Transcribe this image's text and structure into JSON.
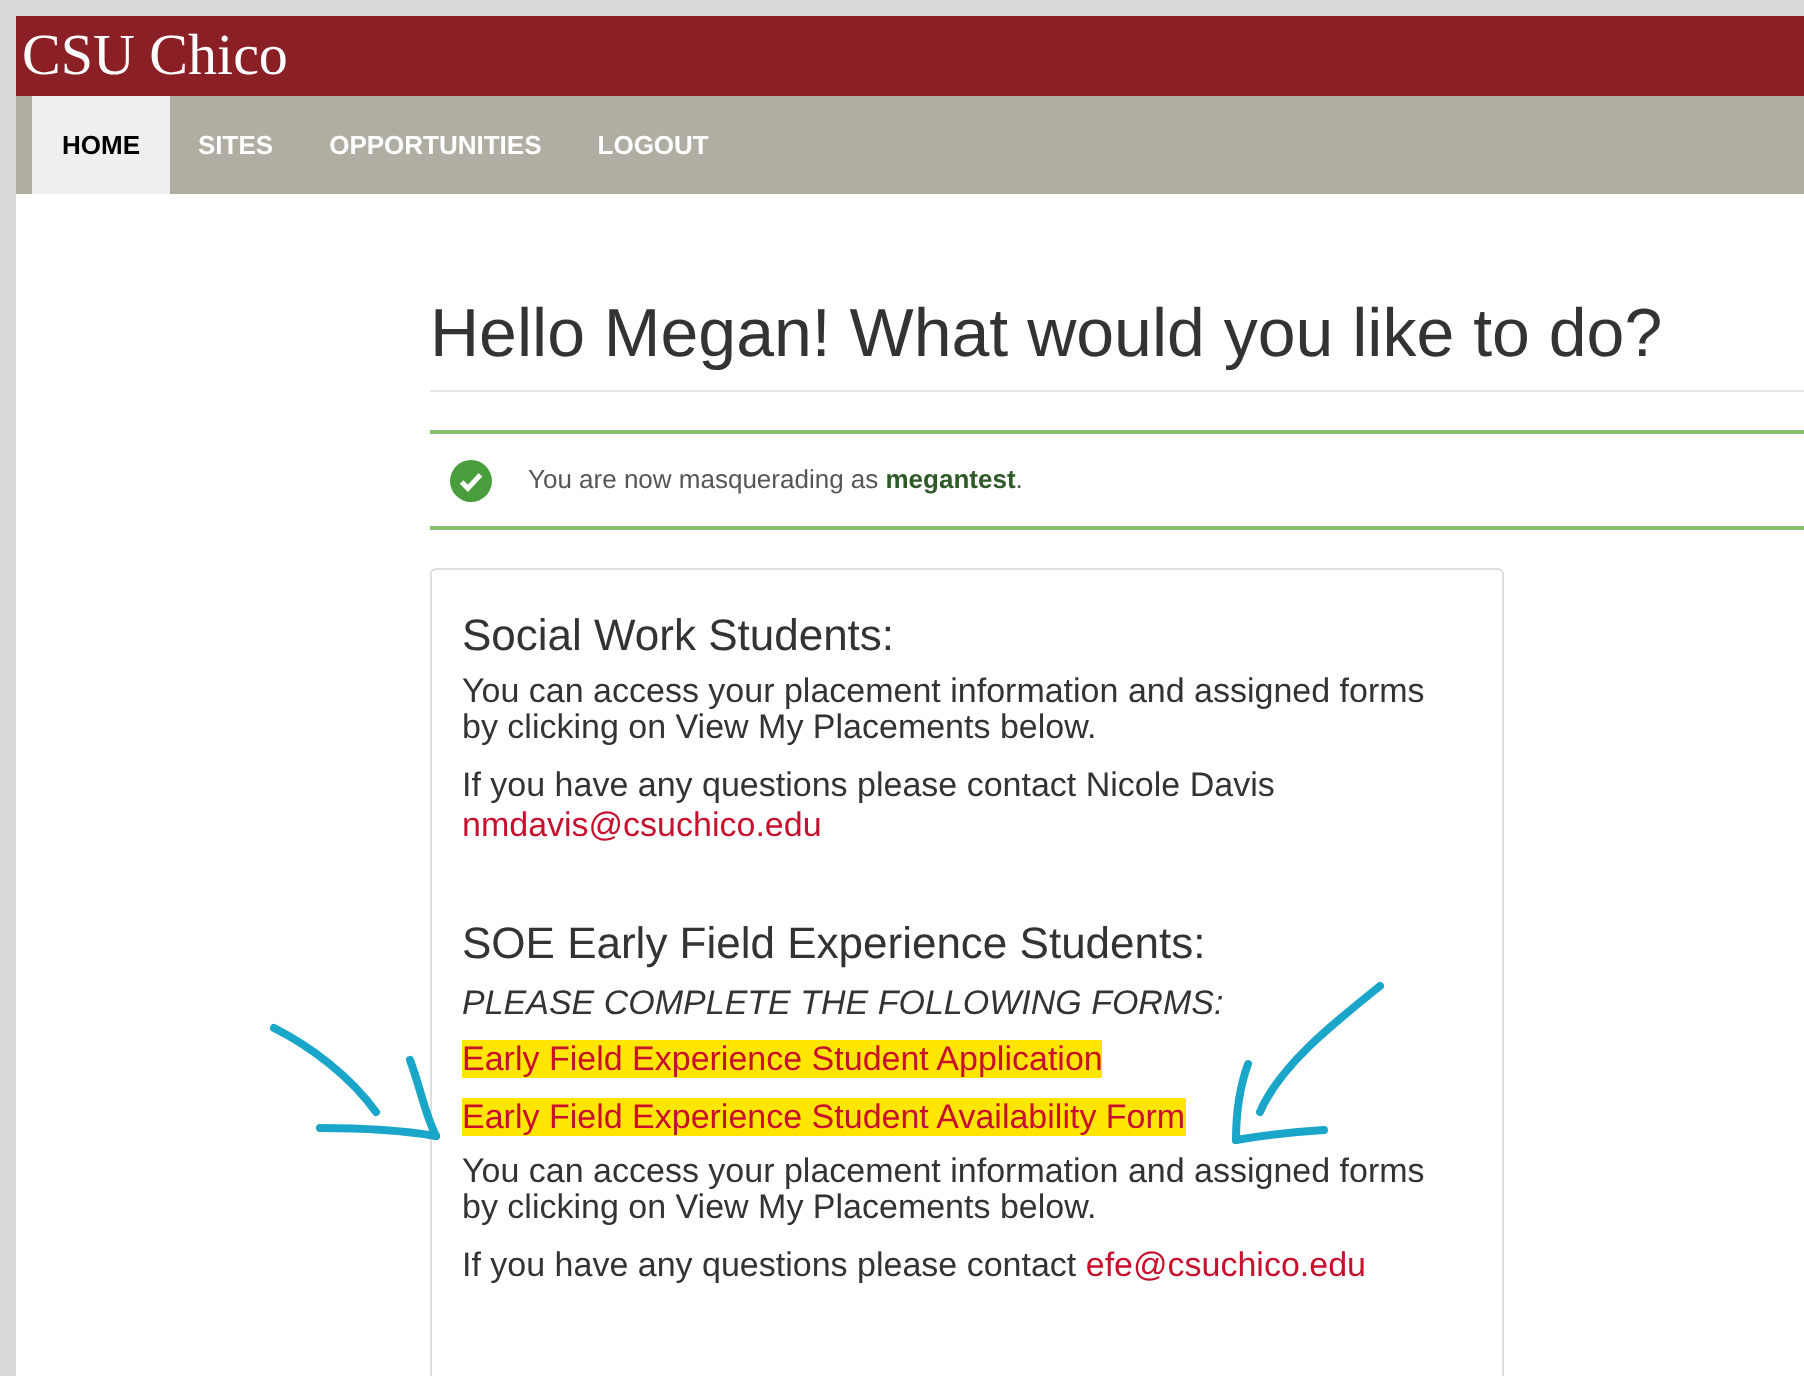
{
  "header": {
    "title": "CSU Chico"
  },
  "nav": [
    {
      "label": "HOME",
      "selected": true
    },
    {
      "label": "SITES",
      "selected": false
    },
    {
      "label": "OPPORTUNITIES",
      "selected": false
    },
    {
      "label": "LOGOUT",
      "selected": false
    }
  ],
  "heading": "Hello Megan! What would you like to do?",
  "alert": {
    "text": "You are now masquerading as **megantest**."
  },
  "sections": [
    {
      "title": "Social Work Students:",
      "items": [
        {
          "kind": "text",
          "text": "You can access your placement information and assigned forms by clicking on View My Placements below."
        },
        {
          "kind": "contact",
          "text": "If you have any questions please contact Nicole Davis",
          "link": "nmdavis@csuchico.edu"
        }
      ]
    },
    {
      "title": "SOE Early Field Experience Students:",
      "items": [
        {
          "kind": "instruction",
          "text": "PLEASE COMPLETE THE FOLLOWING FORMS:"
        },
        {
          "kind": "link",
          "text": "Early Field Experience Student Application",
          "highlighted": true
        },
        {
          "kind": "link",
          "text": "Early Field Experience Student Availability Form",
          "highlighted": true
        },
        {
          "kind": "text",
          "text": "You can access your placement information and assigned forms by clicking on View My Placements below."
        },
        {
          "kind": "contact",
          "text": "If you have any questions please contact",
          "link": "efe@csuchico.edu"
        }
      ]
    }
  ]
}
